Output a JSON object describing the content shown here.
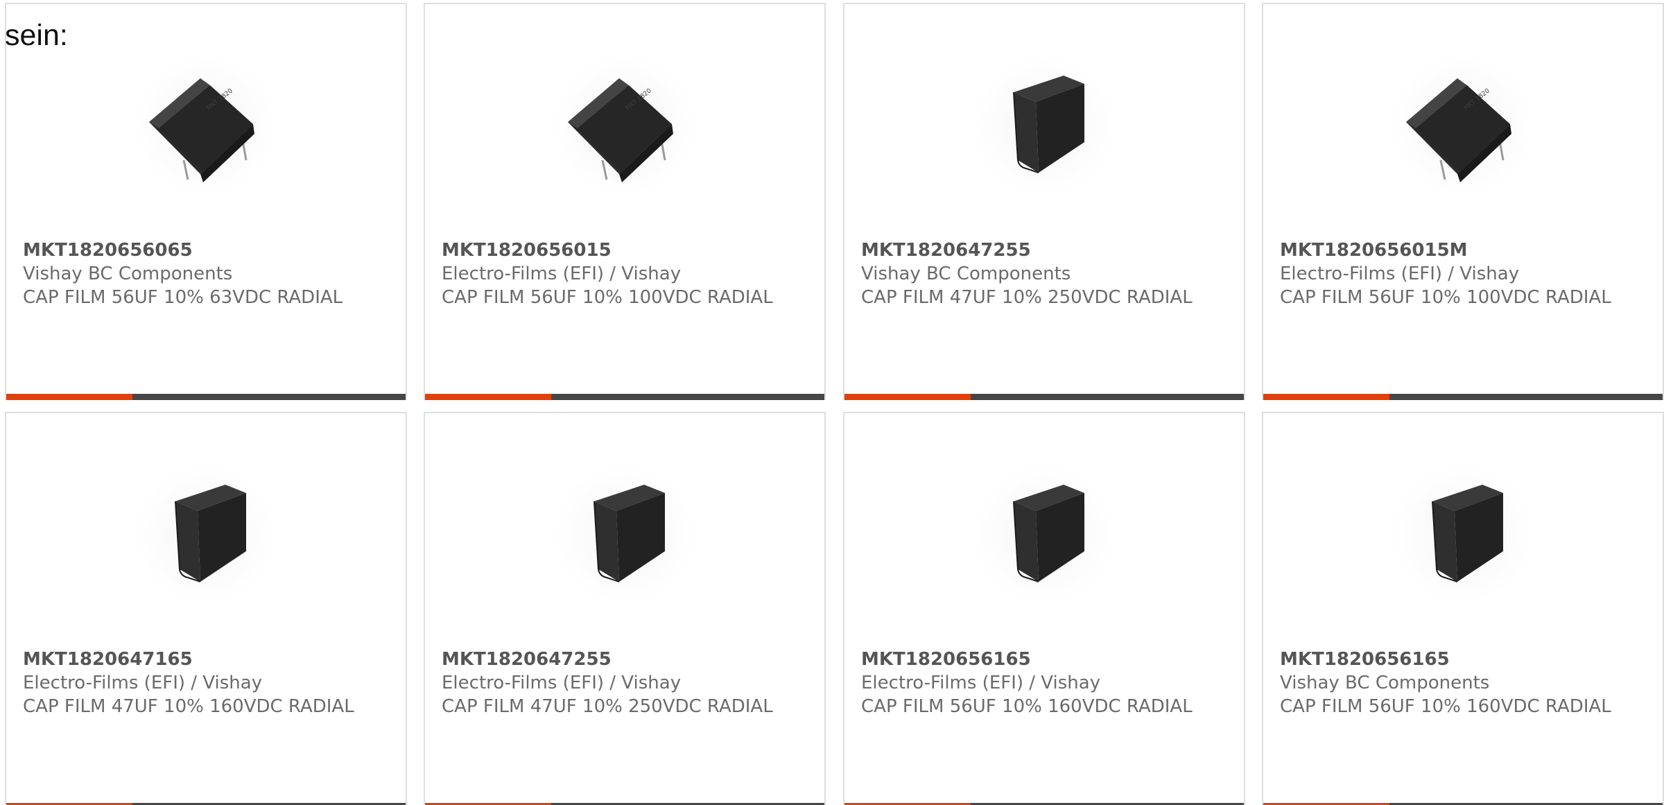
{
  "intro_text": "sein:",
  "colors": {
    "accent": "#e2400b",
    "bar": "#464646",
    "border": "#dedede",
    "text": "#6a6a6a"
  },
  "products": [
    {
      "part_number": "MKT1820656065",
      "manufacturer": "Vishay BC Components",
      "description": "CAP FILM 56UF 10% 63VDC RADIAL",
      "image": "tilted-film-capacitor"
    },
    {
      "part_number": "MKT1820656015",
      "manufacturer": "Electro-Films (EFI) / Vishay",
      "description": "CAP FILM 56UF 10% 100VDC RADIAL",
      "image": "tilted-film-capacitor"
    },
    {
      "part_number": "MKT1820647255",
      "manufacturer": "Vishay BC Components",
      "description": "CAP FILM 47UF 10% 250VDC RADIAL",
      "image": "upright-film-capacitor"
    },
    {
      "part_number": "MKT1820656015M",
      "manufacturer": "Electro-Films (EFI) / Vishay",
      "description": "CAP FILM 56UF 10% 100VDC RADIAL",
      "image": "tilted-film-capacitor"
    },
    {
      "part_number": "MKT1820647165",
      "manufacturer": "Electro-Films (EFI) / Vishay",
      "description": "CAP FILM 47UF 10% 160VDC RADIAL",
      "image": "upright-film-capacitor"
    },
    {
      "part_number": "MKT1820647255",
      "manufacturer": "Electro-Films (EFI) / Vishay",
      "description": "CAP FILM 47UF 10% 250VDC RADIAL",
      "image": "upright-film-capacitor"
    },
    {
      "part_number": "MKT1820656165",
      "manufacturer": "Electro-Films (EFI) / Vishay",
      "description": "CAP FILM 56UF 10% 160VDC RADIAL",
      "image": "upright-film-capacitor"
    },
    {
      "part_number": "MKT1820656165",
      "manufacturer": "Vishay BC Components",
      "description": "CAP FILM 56UF 10% 160VDC RADIAL",
      "image": "upright-film-capacitor"
    }
  ]
}
